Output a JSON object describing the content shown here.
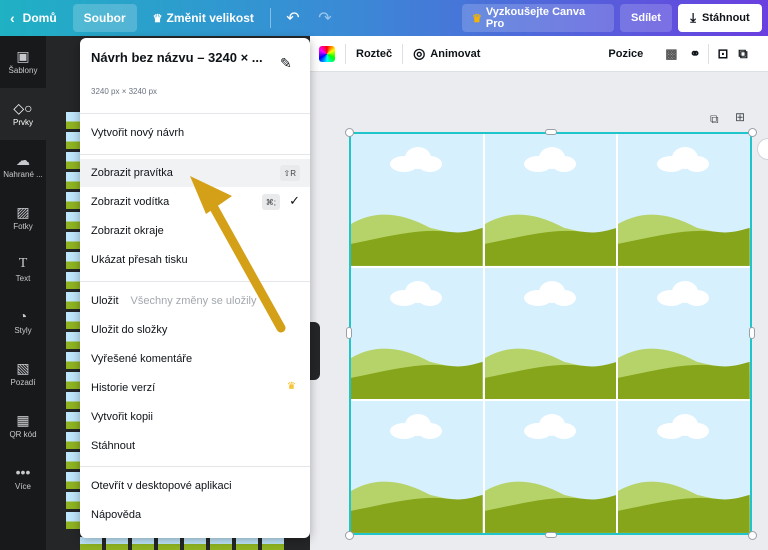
{
  "topbar": {
    "home_label": "Domů",
    "file_label": "Soubor",
    "resize_label": "Změnit velikost",
    "try_pro_label": "Vyzkoušejte Canva Pro",
    "share_label": "Sdílet",
    "download_label": "Stáhnout"
  },
  "rail": {
    "items": [
      {
        "label": "Šablony"
      },
      {
        "label": "Prvky"
      },
      {
        "label": "Nahrané ..."
      },
      {
        "label": "Fotky"
      },
      {
        "label": "Text"
      },
      {
        "label": "Styly"
      },
      {
        "label": "Pozadí"
      },
      {
        "label": "QR kód"
      },
      {
        "label": "Více"
      }
    ]
  },
  "toolbar": {
    "spacing_label": "Rozteč",
    "animate_label": "Animovat",
    "position_label": "Pozice"
  },
  "menu": {
    "title": "Návrh bez názvu – 3240 × ...",
    "dimensions": "3240 px × 3240 px",
    "items": {
      "create_new": "Vytvořit nový návrh",
      "show_rulers": "Zobrazit pravítka",
      "show_rulers_shortcut": "⇧R",
      "show_guides": "Zobrazit vodítka",
      "show_guides_shortcut": "⌘;",
      "show_margins": "Zobrazit okraje",
      "show_bleed": "Ukázat přesah tisku",
      "save": "Uložit",
      "save_status": "Všechny změny se uložily",
      "save_to_folder": "Uložit do složky",
      "resolved_comments": "Vyřešené komentáře",
      "version_history": "Historie verzí",
      "make_copy": "Vytvořit kopii",
      "download": "Stáhnout",
      "open_desktop": "Otevřít v desktopové aplikaci",
      "help": "Nápověda"
    }
  },
  "colors": {
    "accent": "#20c4cb",
    "arrow": "#d4a017",
    "sky": "#d7f0fd",
    "hill_light": "#b6d36a",
    "hill_dark": "#86a51a",
    "rail_bg": "#18191b"
  }
}
